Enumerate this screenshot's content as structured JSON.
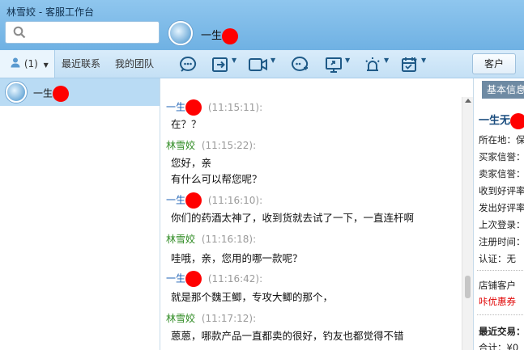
{
  "app": {
    "title": "林雪姣 - 客服工作台"
  },
  "search": {
    "placeholder": ""
  },
  "chat_header": {
    "name": "一生"
  },
  "left_tabs": [
    {
      "label": "(1)"
    },
    {
      "label": "最近联系"
    },
    {
      "label": "我的团队"
    }
  ],
  "contacts": [
    {
      "name": "一生"
    }
  ],
  "toolbar": {
    "icons": [
      "emoji-icon",
      "transfer-icon",
      "video-icon",
      "chat-add-icon",
      "screen-share-icon",
      "alarm-icon",
      "schedule-icon"
    ],
    "customer_label": "客户"
  },
  "messages": [
    {
      "sender": "一生",
      "role": "customer",
      "time": "(11:15:11):",
      "lines": [
        "在？？"
      ]
    },
    {
      "sender": "林雪姣",
      "role": "agent",
      "time": "(11:15:22):",
      "lines": [
        "您好，亲",
        "有什么可以帮您呢？"
      ]
    },
    {
      "sender": "一生",
      "role": "customer",
      "time": "(11:16:10):",
      "lines": [
        "你们的药酒太神了，收到货就去试了一下，一直连杆啊"
      ]
    },
    {
      "sender": "林雪姣",
      "role": "agent",
      "time": "(11:16:18):",
      "lines": [
        "哇哦，亲，您用的哪一款呢？"
      ]
    },
    {
      "sender": "一生",
      "role": "customer",
      "time": "(11:16:42):",
      "lines": [
        "就是那个魏王鲫，专攻大鲫的那个，"
      ]
    },
    {
      "sender": "林雪姣",
      "role": "agent",
      "time": "(11:17:12):",
      "lines": [
        "蒽蒽，哪款产品一直都卖的很好，钓友也都觉得不错"
      ]
    }
  ],
  "info_panel": {
    "tab": "基本信息",
    "name": "一生无",
    "rows": [
      "所在地：保",
      "买家信誉：",
      "卖家信誉：",
      "收到好评率",
      "发出好评率",
      "上次登录：",
      "注册时间：",
      "认证：无"
    ],
    "shop_customer": "店铺客户",
    "coupon": "咔优惠券",
    "recent_trade": "最近交易：",
    "total": "合计：¥0"
  },
  "colors": {
    "header": "#7fbbe8",
    "agent_name": "#2e8b22",
    "customer_name": "#1a5fb4",
    "redaction": "#ff0000"
  }
}
